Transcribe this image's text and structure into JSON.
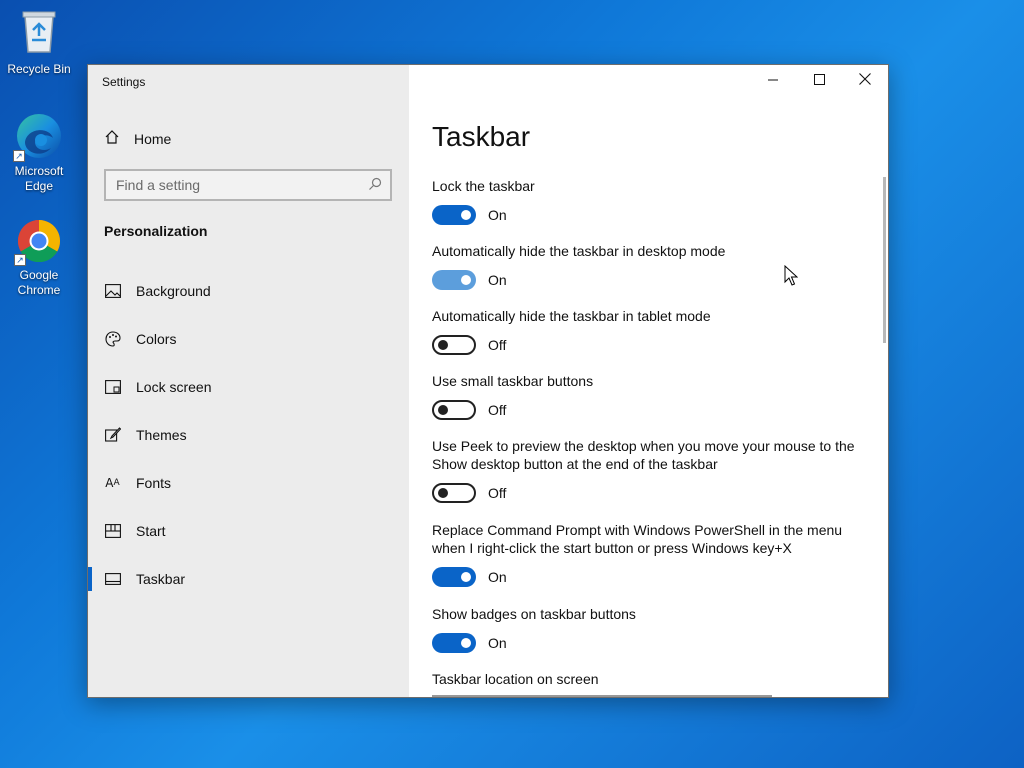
{
  "desktop": {
    "icons": [
      {
        "label": "Recycle Bin",
        "icon": "recycle-bin-icon"
      },
      {
        "label": "Microsoft Edge",
        "icon": "edge-icon"
      },
      {
        "label": "Google Chrome",
        "icon": "chrome-icon"
      }
    ]
  },
  "window": {
    "title": "Settings",
    "minimize": "minimize-icon",
    "maximize": "maximize-icon",
    "close": "close-icon"
  },
  "sidebar": {
    "home_label": "Home",
    "search_placeholder": "Find a setting",
    "section_title": "Personalization",
    "items": [
      {
        "label": "Background",
        "icon": "picture-icon"
      },
      {
        "label": "Colors",
        "icon": "palette-icon"
      },
      {
        "label": "Lock screen",
        "icon": "lock-screen-icon"
      },
      {
        "label": "Themes",
        "icon": "brush-icon"
      },
      {
        "label": "Fonts",
        "icon": "font-icon"
      },
      {
        "label": "Start",
        "icon": "start-icon"
      },
      {
        "label": "Taskbar",
        "icon": "taskbar-icon",
        "active": true
      }
    ]
  },
  "content": {
    "title": "Taskbar",
    "settings": [
      {
        "label": "Lock the taskbar",
        "state": "On"
      },
      {
        "label": "Automatically hide the taskbar in desktop mode",
        "state": "On"
      },
      {
        "label": "Automatically hide the taskbar in tablet mode",
        "state": "Off"
      },
      {
        "label": "Use small taskbar buttons",
        "state": "Off"
      },
      {
        "label": "Use Peek to preview the desktop when you move your mouse to the Show desktop button at the end of the taskbar",
        "state": "Off"
      },
      {
        "label": "Replace Command Prompt with Windows PowerShell in the menu when I right-click the start button or press Windows key+X",
        "state": "On"
      },
      {
        "label": "Show badges on taskbar buttons",
        "state": "On"
      }
    ],
    "location_label": "Taskbar location on screen"
  },
  "colors": {
    "accent": "#0a64c8",
    "accent_hover": "#5c9edc",
    "sidebar_bg": "#ececec"
  }
}
